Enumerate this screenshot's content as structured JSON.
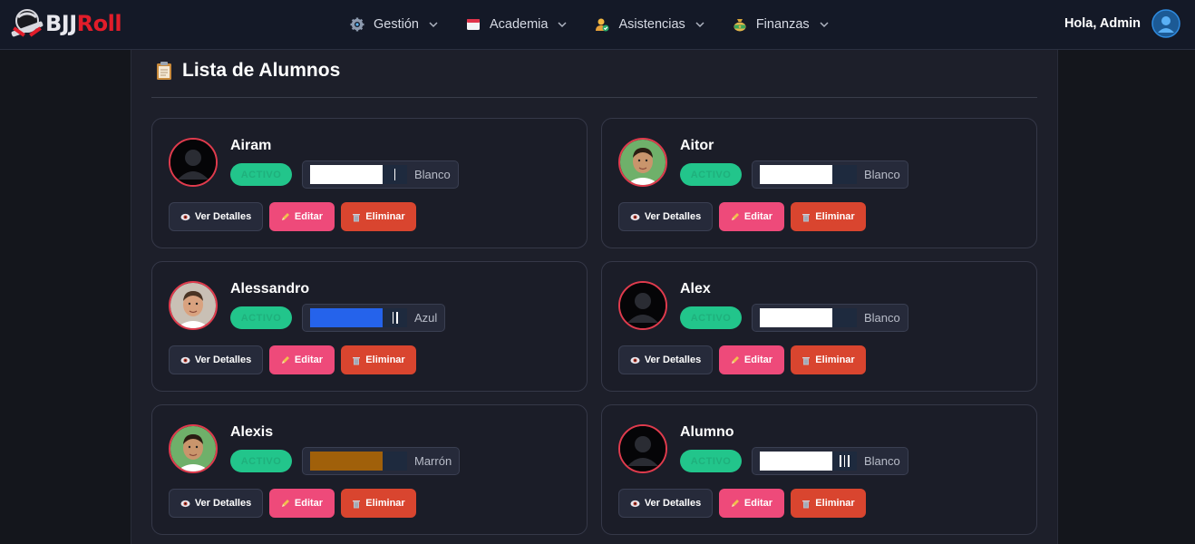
{
  "brand": {
    "part1": "BJJ",
    "part2": "Roll",
    "logo_icon": "gi-belt-logo-icon",
    "accent": "#e11d2a"
  },
  "nav": [
    {
      "label": "Gestión",
      "icon": "gear-icon"
    },
    {
      "label": "Academia",
      "icon": "calendar-icon"
    },
    {
      "label": "Asistencias",
      "icon": "user-check-icon"
    },
    {
      "label": "Finanzas",
      "icon": "money-bag-icon"
    }
  ],
  "user": {
    "greeting": "Hola, Admin",
    "avatar_icon": "user-avatar-icon"
  },
  "page": {
    "title": "Lista de Alumnos",
    "title_icon": "clipboard-icon"
  },
  "buttons": {
    "details": "Ver Detalles",
    "edit": "Editar",
    "delete": "Eliminar"
  },
  "status_colors": {
    "active": "#22c58b"
  },
  "students": [
    {
      "name": "Airam",
      "status": "ACTIVO",
      "belt": "Blanco",
      "belt_color": "#ffffff",
      "stripes": 1,
      "avatar": "default-silhouette"
    },
    {
      "name": "Aitor",
      "status": "ACTIVO",
      "belt": "Blanco",
      "belt_color": "#ffffff",
      "stripes": 0,
      "avatar": "photo"
    },
    {
      "name": "Alessandro",
      "status": "ACTIVO",
      "belt": "Azul",
      "belt_color": "#2563eb",
      "stripes": 2,
      "avatar": "photo"
    },
    {
      "name": "Alex",
      "status": "ACTIVO",
      "belt": "Blanco",
      "belt_color": "#ffffff",
      "stripes": 0,
      "avatar": "default-silhouette"
    },
    {
      "name": "Alexis",
      "status": "ACTIVO",
      "belt": "Marrón",
      "belt_color": "#a0600a",
      "stripes": 0,
      "avatar": "photo"
    },
    {
      "name": "Alumno",
      "status": "ACTIVO",
      "belt": "Blanco",
      "belt_color": "#ffffff",
      "stripes": 3,
      "avatar": "default-silhouette"
    }
  ]
}
